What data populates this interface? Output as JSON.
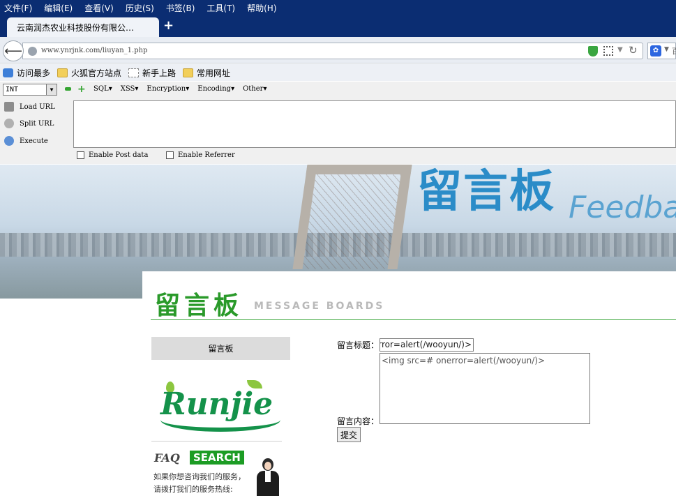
{
  "browser": {
    "menu": [
      "文件(F)",
      "编辑(E)",
      "查看(V)",
      "历史(S)",
      "书签(B)",
      "工具(T)",
      "帮助(H)"
    ],
    "tab_title": "云南润杰农业科技股份有限公…",
    "new_tab": "+",
    "url": "www.ynrjnk.com/liuyan_1.php",
    "search_engine_text": "百"
  },
  "bookmarks": [
    {
      "label": "访问最多",
      "icon": "magnifier-icon"
    },
    {
      "label": "火狐官方站点",
      "icon": "folder-icon"
    },
    {
      "label": "新手上路",
      "icon": "blank-page-icon"
    },
    {
      "label": "常用网址",
      "icon": "folder-icon"
    }
  ],
  "hackbar": {
    "type_select": "INT",
    "menus": [
      "SQL▾",
      "XSS▾",
      "Encryption▾",
      "Encoding▾",
      "Other▾"
    ],
    "actions": [
      {
        "label": "Load URL",
        "icon": "load-url-icon"
      },
      {
        "label": "Split URL",
        "icon": "scissors-icon"
      },
      {
        "label": "Execute",
        "icon": "play-icon"
      }
    ],
    "enable_post": "Enable Post data",
    "enable_referrer": "Enable Referrer"
  },
  "banner": {
    "cn": "留言板",
    "en": "Feedba"
  },
  "page": {
    "title_cn": "留言板",
    "title_en": "MESSAGE BOARDS",
    "side_button": "留言板",
    "logo_text": "Runjie",
    "faq": "FAQ",
    "search_badge": "SEARCH",
    "service_line1": "如果你想咨询我们的服务，",
    "service_line2": "请拨打我们的服务热线:",
    "label_title": "留言标题：",
    "title_value": "<img src=# onerror=alert(/wooyun/)>",
    "label_content": "留言内容：",
    "content_value": "<img src=# onerror=alert(/wooyun/)>",
    "submit": "提交"
  }
}
